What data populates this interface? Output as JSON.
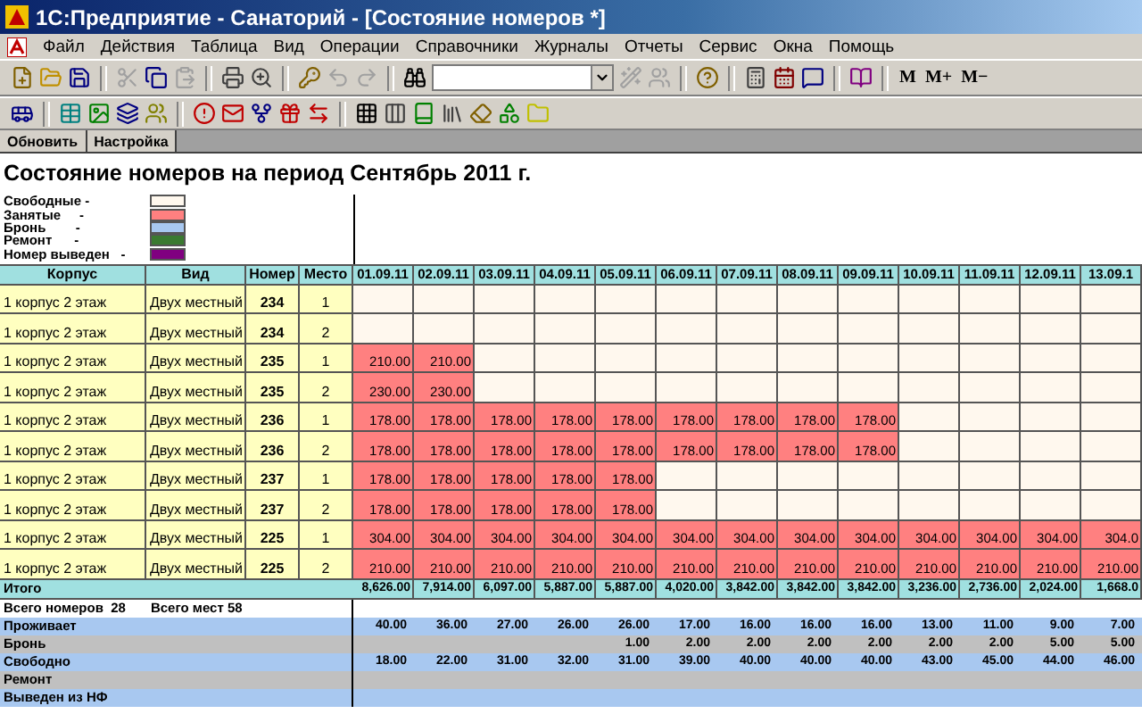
{
  "window": {
    "title": "1С:Предприятие - Санаторий - [Состояние номеров  *]"
  },
  "menu": [
    "Файл",
    "Действия",
    "Таблица",
    "Вид",
    "Операции",
    "Справочники",
    "Журналы",
    "Отчеты",
    "Сервис",
    "Окна",
    "Помощь"
  ],
  "toolbar_1": [
    {
      "kind": "icon",
      "disabled": false
    },
    {
      "kind": "icon",
      "disabled": false
    },
    {
      "kind": "icon",
      "disabled": false
    },
    {
      "kind": "separator"
    },
    {
      "kind": "icon",
      "disabled": true
    },
    {
      "kind": "icon",
      "disabled": false
    },
    {
      "kind": "icon",
      "disabled": true
    },
    {
      "kind": "separator"
    },
    {
      "kind": "icon",
      "disabled": false
    },
    {
      "kind": "icon",
      "disabled": false
    },
    {
      "kind": "separator"
    },
    {
      "kind": "icon",
      "disabled": false
    },
    {
      "kind": "icon",
      "disabled": true
    },
    {
      "kind": "icon",
      "disabled": true
    },
    {
      "kind": "separator"
    },
    {
      "kind": "icon",
      "disabled": false
    },
    {
      "kind": "combo"
    },
    {
      "kind": "icon",
      "disabled": true
    },
    {
      "kind": "icon",
      "disabled": true
    },
    {
      "kind": "separator"
    },
    {
      "kind": "icon",
      "disabled": false
    },
    {
      "kind": "separator"
    },
    {
      "kind": "icon",
      "disabled": false
    },
    {
      "kind": "icon",
      "disabled": false
    },
    {
      "kind": "icon",
      "disabled": false
    },
    {
      "kind": "separator"
    },
    {
      "kind": "icon",
      "disabled": false
    },
    {
      "kind": "separator"
    },
    {
      "kind": "text",
      "label": "M"
    },
    {
      "kind": "text",
      "label": "M+"
    },
    {
      "kind": "text",
      "label": "M−"
    }
  ],
  "toolbar_2": [
    {
      "kind": "icon",
      "disabled": false
    },
    {
      "kind": "separator"
    },
    {
      "kind": "icon",
      "disabled": false
    },
    {
      "kind": "icon",
      "disabled": false
    },
    {
      "kind": "icon",
      "disabled": false
    },
    {
      "kind": "icon",
      "disabled": false
    },
    {
      "kind": "separator"
    },
    {
      "kind": "icon",
      "disabled": false
    },
    {
      "kind": "icon",
      "disabled": false
    },
    {
      "kind": "icon",
      "disabled": false
    },
    {
      "kind": "icon",
      "disabled": false
    },
    {
      "kind": "icon",
      "disabled": false
    },
    {
      "kind": "separator"
    },
    {
      "kind": "icon",
      "disabled": false
    },
    {
      "kind": "icon",
      "disabled": false
    },
    {
      "kind": "icon",
      "disabled": false
    },
    {
      "kind": "icon",
      "disabled": false
    },
    {
      "kind": "icon",
      "disabled": false
    },
    {
      "kind": "icon",
      "disabled": false
    },
    {
      "kind": "icon",
      "disabled": false
    }
  ],
  "form_buttons": [
    "Обновить",
    "Настройка"
  ],
  "report": {
    "title": "Состояние номеров на период Сентябрь 2011 г.",
    "legend": [
      {
        "label": "Свободные -",
        "color": "#fff8ee"
      },
      {
        "label": "Занятые     -",
        "color": "#ff8080"
      },
      {
        "label": "Бронь        -",
        "color": "#a8c8f0"
      },
      {
        "label": "Ремонт      -",
        "color": "#3a7a30"
      },
      {
        "label": "Номер выведен   -",
        "color": "#800080"
      }
    ],
    "columns": [
      "Корпус",
      "Вид",
      "Номер",
      "Место"
    ],
    "dates": [
      "01.09.11",
      "02.09.11",
      "03.09.11",
      "04.09.11",
      "05.09.11",
      "06.09.11",
      "07.09.11",
      "08.09.11",
      "09.09.11",
      "10.09.11",
      "11.09.11",
      "12.09.11",
      "13.09.1"
    ],
    "rows": [
      {
        "korpus": "1 корпус 2 этаж",
        "vid": "Двух местный",
        "nomer": "234",
        "mesto": "1",
        "cells": [
          {
            "occupied": false
          },
          {
            "occupied": false
          },
          {
            "occupied": false
          },
          {
            "occupied": false
          },
          {
            "occupied": false
          },
          {
            "occupied": false
          },
          {
            "occupied": false
          },
          {
            "occupied": false
          },
          {
            "occupied": false
          },
          {
            "occupied": false
          },
          {
            "occupied": false
          },
          {
            "occupied": false
          },
          {
            "occupied": false
          }
        ]
      },
      {
        "korpus": "1 корпус 2 этаж",
        "vid": "Двух местный",
        "nomer": "234",
        "mesto": "2",
        "cells": [
          {
            "occupied": false
          },
          {
            "occupied": false
          },
          {
            "occupied": false
          },
          {
            "occupied": false
          },
          {
            "occupied": false
          },
          {
            "occupied": false
          },
          {
            "occupied": false
          },
          {
            "occupied": false
          },
          {
            "occupied": false
          },
          {
            "occupied": false
          },
          {
            "occupied": false
          },
          {
            "occupied": false
          },
          {
            "occupied": false
          }
        ]
      },
      {
        "korpus": "1 корпус 2 этаж",
        "vid": "Двух местный",
        "nomer": "235",
        "mesto": "1",
        "cells": [
          {
            "occupied": true,
            "value": "210.00"
          },
          {
            "occupied": true,
            "value": "210.00"
          },
          {
            "occupied": false
          },
          {
            "occupied": false
          },
          {
            "occupied": false
          },
          {
            "occupied": false
          },
          {
            "occupied": false
          },
          {
            "occupied": false
          },
          {
            "occupied": false
          },
          {
            "occupied": false
          },
          {
            "occupied": false
          },
          {
            "occupied": false
          },
          {
            "occupied": false
          }
        ]
      },
      {
        "korpus": "1 корпус 2 этаж",
        "vid": "Двух местный",
        "nomer": "235",
        "mesto": "2",
        "cells": [
          {
            "occupied": true,
            "value": "230.00"
          },
          {
            "occupied": true,
            "value": "230.00"
          },
          {
            "occupied": false
          },
          {
            "occupied": false
          },
          {
            "occupied": false
          },
          {
            "occupied": false
          },
          {
            "occupied": false
          },
          {
            "occupied": false
          },
          {
            "occupied": false
          },
          {
            "occupied": false
          },
          {
            "occupied": false
          },
          {
            "occupied": false
          },
          {
            "occupied": false
          }
        ]
      },
      {
        "korpus": "1 корпус 2 этаж",
        "vid": "Двух местный",
        "nomer": "236",
        "mesto": "1",
        "cells": [
          {
            "occupied": true,
            "value": "178.00"
          },
          {
            "occupied": true,
            "value": "178.00"
          },
          {
            "occupied": true,
            "value": "178.00"
          },
          {
            "occupied": true,
            "value": "178.00"
          },
          {
            "occupied": true,
            "value": "178.00"
          },
          {
            "occupied": true,
            "value": "178.00"
          },
          {
            "occupied": true,
            "value": "178.00"
          },
          {
            "occupied": true,
            "value": "178.00"
          },
          {
            "occupied": true,
            "value": "178.00"
          },
          {
            "occupied": false
          },
          {
            "occupied": false
          },
          {
            "occupied": false
          },
          {
            "occupied": false
          }
        ]
      },
      {
        "korpus": "1 корпус 2 этаж",
        "vid": "Двух местный",
        "nomer": "236",
        "mesto": "2",
        "cells": [
          {
            "occupied": true,
            "value": "178.00"
          },
          {
            "occupied": true,
            "value": "178.00"
          },
          {
            "occupied": true,
            "value": "178.00"
          },
          {
            "occupied": true,
            "value": "178.00"
          },
          {
            "occupied": true,
            "value": "178.00"
          },
          {
            "occupied": true,
            "value": "178.00"
          },
          {
            "occupied": true,
            "value": "178.00"
          },
          {
            "occupied": true,
            "value": "178.00"
          },
          {
            "occupied": true,
            "value": "178.00"
          },
          {
            "occupied": false
          },
          {
            "occupied": false
          },
          {
            "occupied": false
          },
          {
            "occupied": false
          }
        ]
      },
      {
        "korpus": "1 корпус 2 этаж",
        "vid": "Двух местный",
        "nomer": "237",
        "mesto": "1",
        "cells": [
          {
            "occupied": true,
            "value": "178.00"
          },
          {
            "occupied": true,
            "value": "178.00"
          },
          {
            "occupied": true,
            "value": "178.00"
          },
          {
            "occupied": true,
            "value": "178.00"
          },
          {
            "occupied": true,
            "value": "178.00"
          },
          {
            "occupied": false
          },
          {
            "occupied": false
          },
          {
            "occupied": false
          },
          {
            "occupied": false
          },
          {
            "occupied": false
          },
          {
            "occupied": false
          },
          {
            "occupied": false
          },
          {
            "occupied": false
          }
        ]
      },
      {
        "korpus": "1 корпус 2 этаж",
        "vid": "Двух местный",
        "nomer": "237",
        "mesto": "2",
        "cells": [
          {
            "occupied": true,
            "value": "178.00"
          },
          {
            "occupied": true,
            "value": "178.00"
          },
          {
            "occupied": true,
            "value": "178.00"
          },
          {
            "occupied": true,
            "value": "178.00"
          },
          {
            "occupied": true,
            "value": "178.00"
          },
          {
            "occupied": false
          },
          {
            "occupied": false
          },
          {
            "occupied": false
          },
          {
            "occupied": false
          },
          {
            "occupied": false
          },
          {
            "occupied": false
          },
          {
            "occupied": false
          },
          {
            "occupied": false
          }
        ]
      },
      {
        "korpus": "1 корпус 2 этаж",
        "vid": "Двух местный",
        "nomer": "225",
        "mesto": "1",
        "cells": [
          {
            "occupied": true,
            "value": "304.00"
          },
          {
            "occupied": true,
            "value": "304.00"
          },
          {
            "occupied": true,
            "value": "304.00"
          },
          {
            "occupied": true,
            "value": "304.00"
          },
          {
            "occupied": true,
            "value": "304.00"
          },
          {
            "occupied": true,
            "value": "304.00"
          },
          {
            "occupied": true,
            "value": "304.00"
          },
          {
            "occupied": true,
            "value": "304.00"
          },
          {
            "occupied": true,
            "value": "304.00"
          },
          {
            "occupied": true,
            "value": "304.00"
          },
          {
            "occupied": true,
            "value": "304.00"
          },
          {
            "occupied": true,
            "value": "304.00"
          },
          {
            "occupied": true,
            "value": "304.0"
          }
        ]
      },
      {
        "korpus": "1 корпус 2 этаж",
        "vid": "Двух местный",
        "nomer": "225",
        "mesto": "2",
        "cells": [
          {
            "occupied": true,
            "value": "210.00"
          },
          {
            "occupied": true,
            "value": "210.00"
          },
          {
            "occupied": true,
            "value": "210.00"
          },
          {
            "occupied": true,
            "value": "210.00"
          },
          {
            "occupied": true,
            "value": "210.00"
          },
          {
            "occupied": true,
            "value": "210.00"
          },
          {
            "occupied": true,
            "value": "210.00"
          },
          {
            "occupied": true,
            "value": "210.00"
          },
          {
            "occupied": true,
            "value": "210.00"
          },
          {
            "occupied": true,
            "value": "210.00"
          },
          {
            "occupied": true,
            "value": "210.00"
          },
          {
            "occupied": true,
            "value": "210.00"
          },
          {
            "occupied": true,
            "value": "210.00"
          }
        ]
      }
    ],
    "total": {
      "label": "Итого",
      "values": [
        "8,626.00",
        "7,914.00",
        "6,097.00",
        "5,887.00",
        "5,887.00",
        "4,020.00",
        "3,842.00",
        "3,842.00",
        "3,842.00",
        "3,236.00",
        "2,736.00",
        "2,024.00",
        "1,668.0"
      ]
    },
    "counts": [
      "Всего номеров  28",
      "Всего мест 58"
    ],
    "summary": [
      {
        "label": "Проживает",
        "values": [
          "40.00",
          "36.00",
          "27.00",
          "26.00",
          "26.00",
          "17.00",
          "16.00",
          "16.00",
          "16.00",
          "13.00",
          "11.00",
          "9.00",
          "7.00"
        ]
      },
      {
        "label": "Бронь",
        "values": [
          "1.00",
          "2.00",
          "2.00",
          "2.00",
          "2.00",
          "2.00",
          "2.00",
          "5.00",
          "5.00"
        ]
      },
      {
        "label": "Свободно",
        "values": [
          "18.00",
          "22.00",
          "31.00",
          "32.00",
          "31.00",
          "39.00",
          "40.00",
          "40.00",
          "40.00",
          "43.00",
          "45.00",
          "44.00",
          "46.00"
        ]
      },
      {
        "label": "Ремонт"
      },
      {
        "label": "Выведен из НФ"
      }
    ]
  }
}
